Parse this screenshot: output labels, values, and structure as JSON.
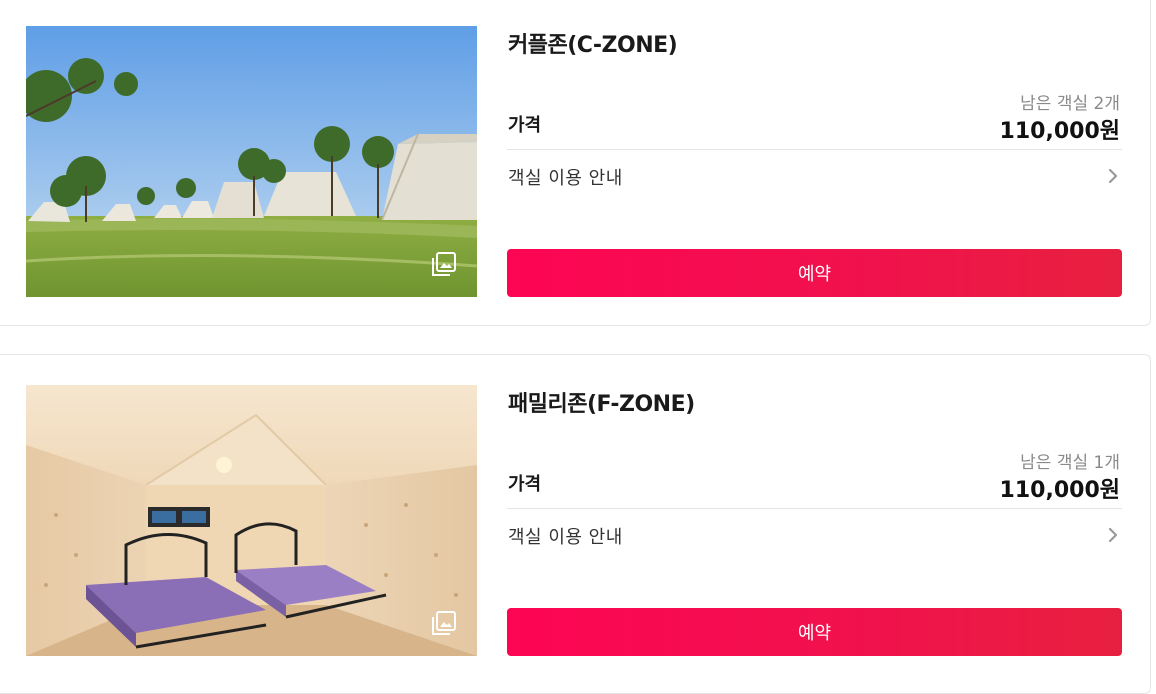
{
  "rooms": [
    {
      "name": "커플존(C-ZONE)",
      "price_label": "가격",
      "remaining": "남은 객실 2개",
      "price": "110,000원",
      "guide_label": "객실 이용 안내",
      "reserve_label": "예약",
      "photo_icon": "gallery-icon"
    },
    {
      "name": "패밀리존(F-ZONE)",
      "price_label": "가격",
      "remaining": "남은 객실 1개",
      "price": "110,000원",
      "guide_label": "객실 이용 안내",
      "reserve_label": "예약",
      "photo_icon": "gallery-icon"
    }
  ],
  "colors": {
    "accent": "#fd0554",
    "accent_end": "#e8203f",
    "text_muted": "#8a8a8a",
    "divider": "#e4e4e4"
  }
}
